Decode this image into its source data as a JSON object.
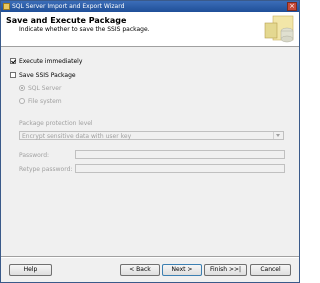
{
  "window": {
    "title": "SQL Server Import and Export Wizard",
    "close_symbol": "×"
  },
  "header": {
    "title": "Save and Execute Package",
    "subtitle": "Indicate whether to save the SSIS package.",
    "graphic_icon": "wizard-graphic-icon"
  },
  "options": {
    "execute_immediately": {
      "label": "Execute immediately",
      "checked": true
    },
    "save_ssis_package": {
      "label": "Save SSIS Package",
      "checked": false
    },
    "sql_server": {
      "label": "SQL Server",
      "selected": true,
      "enabled": false
    },
    "file_system": {
      "label": "File system",
      "selected": false,
      "enabled": false
    }
  },
  "protection": {
    "label": "Package protection level",
    "value": "Encrypt sensitive data with user key"
  },
  "password": {
    "label": "Password:",
    "value": ""
  },
  "retype_password": {
    "label": "Retype password:",
    "value": ""
  },
  "buttons": {
    "help": "Help",
    "back": "< Back",
    "next": "Next >",
    "finish": "Finish >>|",
    "cancel": "Cancel"
  }
}
